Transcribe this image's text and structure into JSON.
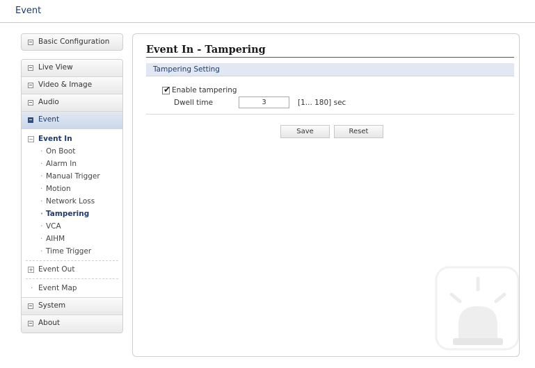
{
  "header": {
    "title": "Event"
  },
  "sidebar": {
    "basic_config": "Basic Configuration",
    "items": [
      "Live View",
      "Video & Image",
      "Audio",
      "Event"
    ],
    "event_sub": {
      "event_in": "Event In",
      "event_in_items": [
        "On Boot",
        "Alarm In",
        "Manual Trigger",
        "Motion",
        "Network Loss",
        "Tampering",
        "VCA",
        "AIHM",
        "Time Trigger"
      ],
      "event_out": "Event Out",
      "event_map": "Event Map"
    },
    "bottom_items": [
      "System",
      "About"
    ]
  },
  "main": {
    "title": "Event In - Tampering",
    "section": "Tampering Setting",
    "enable_label": "Enable tampering",
    "enable_checked": true,
    "dwell_label": "Dwell time",
    "dwell_value": "3",
    "dwell_range": "[1... 180] sec",
    "save_label": "Save",
    "reset_label": "Reset"
  },
  "colors": {
    "accent": "#1f3b6e",
    "section_bg": "#e1e8f3"
  },
  "icons": {
    "checkbox_mark": "✔"
  }
}
